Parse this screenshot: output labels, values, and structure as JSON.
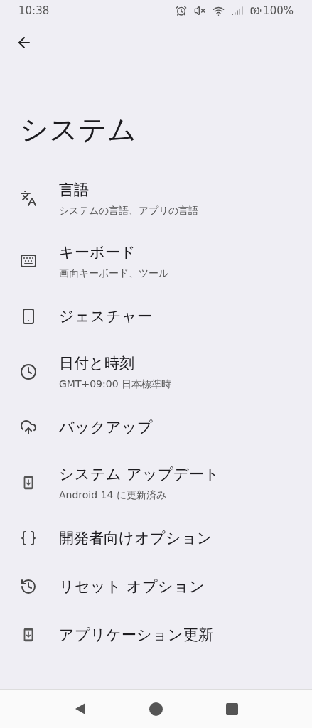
{
  "status_bar": {
    "time": "10:38",
    "battery": "100%"
  },
  "title": "システム",
  "items": [
    {
      "title": "言語",
      "subtitle": "システムの言語、アプリの言語"
    },
    {
      "title": "キーボード",
      "subtitle": "画面キーボード、ツール"
    },
    {
      "title": "ジェスチャー"
    },
    {
      "title": "日付と時刻",
      "subtitle": "GMT+09:00 日本標準時"
    },
    {
      "title": "バックアップ"
    },
    {
      "title": "システム アップデート",
      "subtitle": "Android 14 に更新済み"
    },
    {
      "title": "開発者向けオプション"
    },
    {
      "title": "リセット オプション"
    },
    {
      "title": "アプリケーション更新"
    }
  ]
}
